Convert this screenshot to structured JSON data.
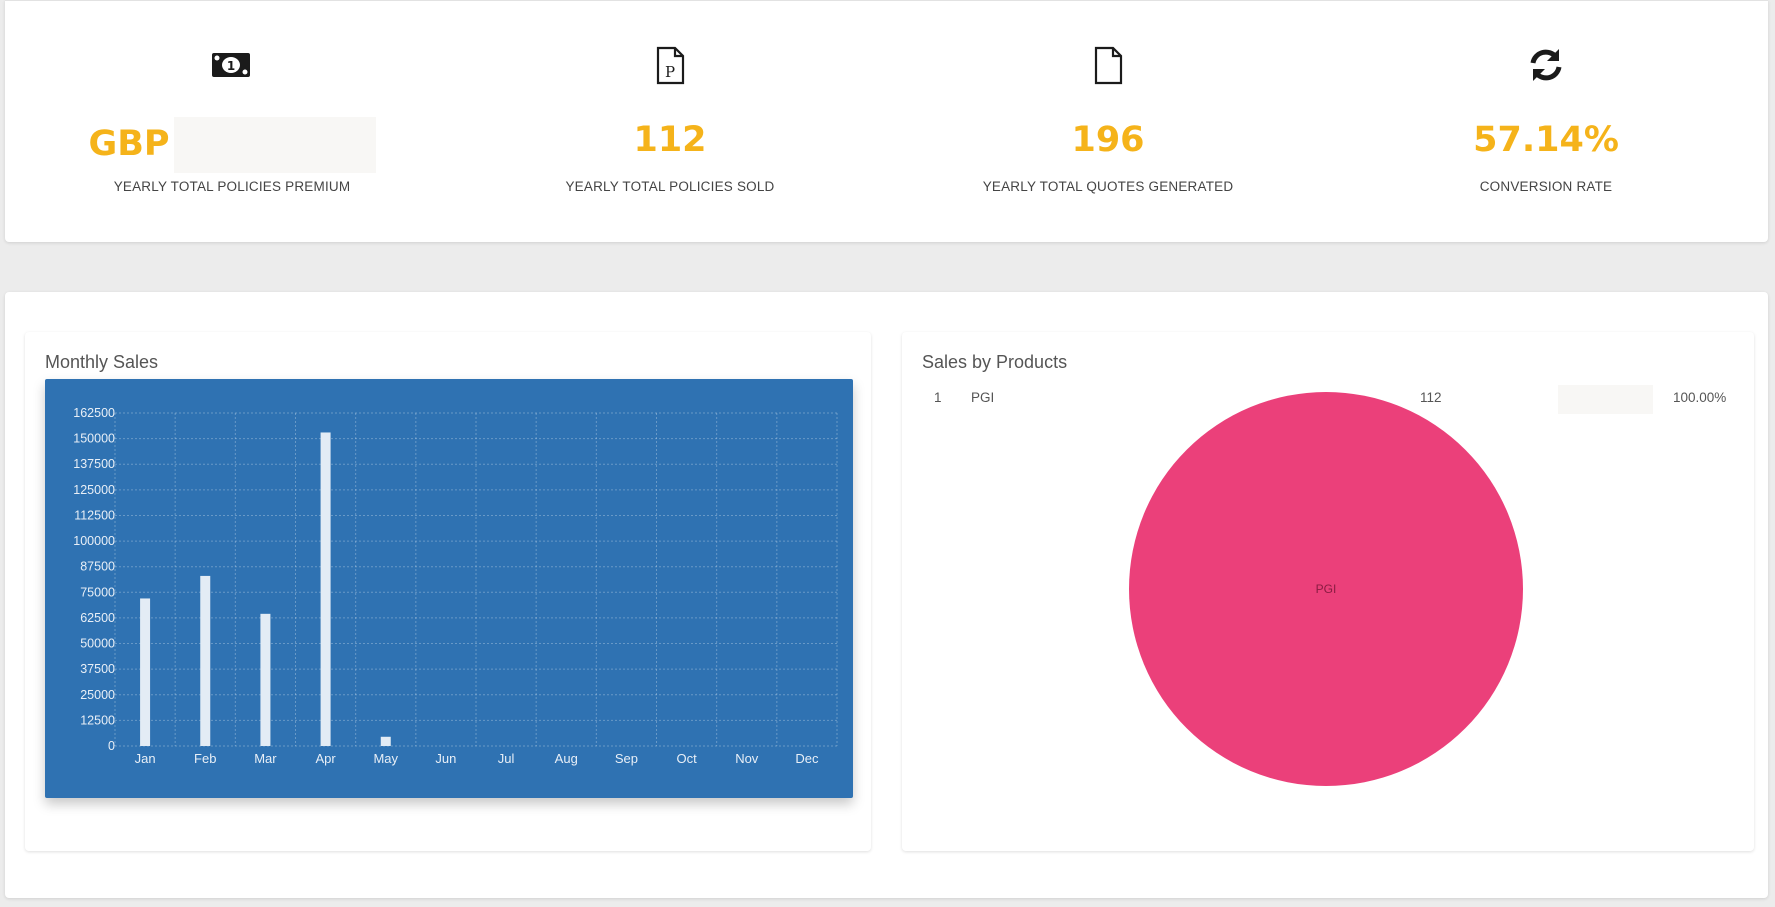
{
  "stats": [
    {
      "icon": "money-bill-icon",
      "currency": "GBP",
      "value": "",
      "label": "YEARLY TOTAL POLICIES PREMIUM"
    },
    {
      "icon": "file-p-icon",
      "value": "112",
      "label": "YEARLY TOTAL POLICIES SOLD"
    },
    {
      "icon": "file-icon",
      "value": "196",
      "label": "YEARLY TOTAL QUOTES GENERATED"
    },
    {
      "icon": "refresh-icon",
      "value": "57.14%",
      "label": "CONVERSION RATE"
    }
  ],
  "monthly": {
    "title": "Monthly Sales"
  },
  "products": {
    "title": "Sales by Products",
    "rows": [
      {
        "rank": "1",
        "name": "PGI",
        "count": "112",
        "percent": "100.00%"
      }
    ]
  },
  "colors": {
    "accent": "#f5b31a",
    "bar_panel": "#2f72b2",
    "bar": "#e3ecf5",
    "pie": "#eb407a"
  },
  "chart_data": [
    {
      "type": "bar",
      "title": "Monthly Sales",
      "categories": [
        "Jan",
        "Feb",
        "Mar",
        "Apr",
        "May",
        "Jun",
        "Jul",
        "Aug",
        "Sep",
        "Oct",
        "Nov",
        "Dec"
      ],
      "values": [
        72000,
        83000,
        64500,
        153000,
        4500,
        0,
        0,
        0,
        0,
        0,
        0,
        0
      ],
      "yticks": [
        "0",
        "12500",
        "25000",
        "37500",
        "50000",
        "62500",
        "75000",
        "87500",
        "100000",
        "112500",
        "125000",
        "137500",
        "150000",
        "162500"
      ],
      "ylim": [
        0,
        162500
      ],
      "grid": true
    },
    {
      "type": "pie",
      "title": "Sales by Products",
      "labels": [
        "PGI"
      ],
      "values": [
        112
      ],
      "percent": [
        100
      ]
    }
  ]
}
